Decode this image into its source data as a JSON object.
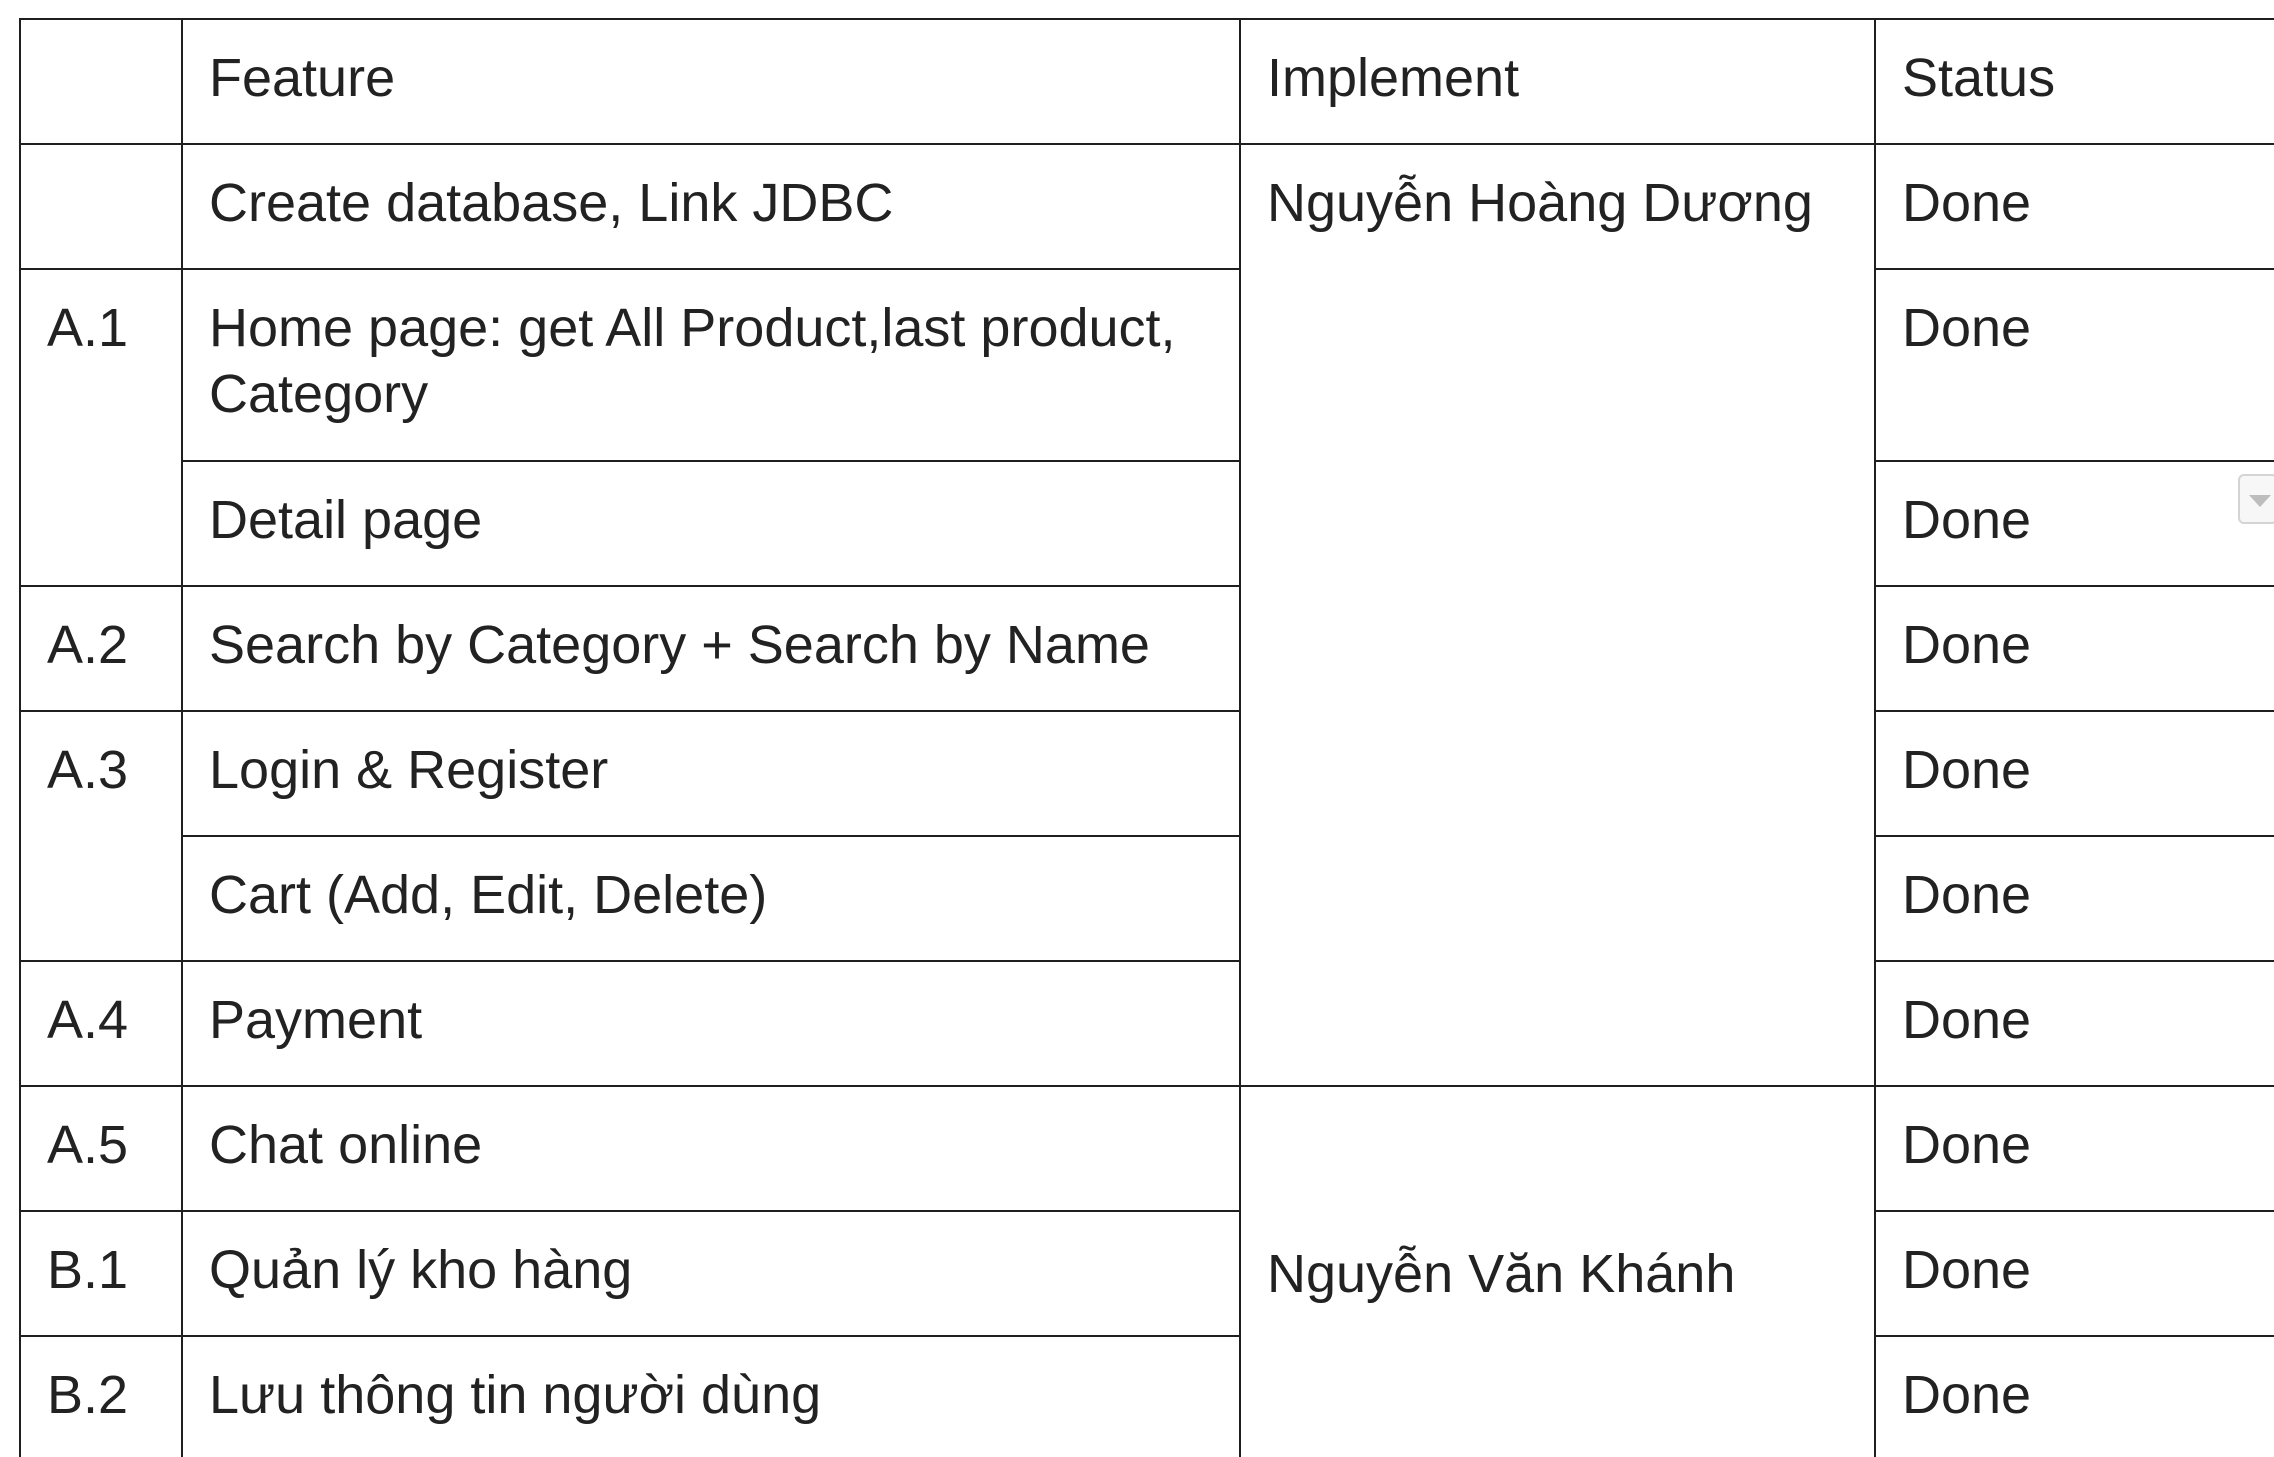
{
  "table": {
    "headers": {
      "code": "",
      "feature": "Feature",
      "implement": "Implement",
      "status": "Status"
    },
    "rows": [
      {
        "code": "",
        "feature": "Create database, Link JDBC",
        "status": "Done"
      },
      {
        "code": "A.1",
        "feature": "Home page: get All Product,last product, Category",
        "status": "Done"
      },
      {
        "code": "",
        "feature": "Detail page",
        "status": "Done"
      },
      {
        "code": "A.2",
        "feature": "Search by Category + Search by Name",
        "status": "Done"
      },
      {
        "code": "A.3",
        "feature": "Login & Register",
        "status": "Done"
      },
      {
        "code": "",
        "feature": "Cart (Add, Edit, Delete)",
        "status": "Done"
      },
      {
        "code": "A.4",
        "feature": "Payment",
        "status": "Done"
      },
      {
        "code": "A.5",
        "feature": "Chat online",
        "status": "Done"
      },
      {
        "code": "B.1",
        "feature": "Quản lý kho hàng",
        "status": "Done"
      },
      {
        "code": "B.2",
        "feature": "Lưu thông tin người dùng",
        "status": "Done"
      }
    ],
    "implementers": [
      "Nguyễn Hoàng Dương",
      "Nguyễn Văn Khánh"
    ]
  },
  "icons": {
    "status_dropdown": "chevron-down-icon"
  }
}
